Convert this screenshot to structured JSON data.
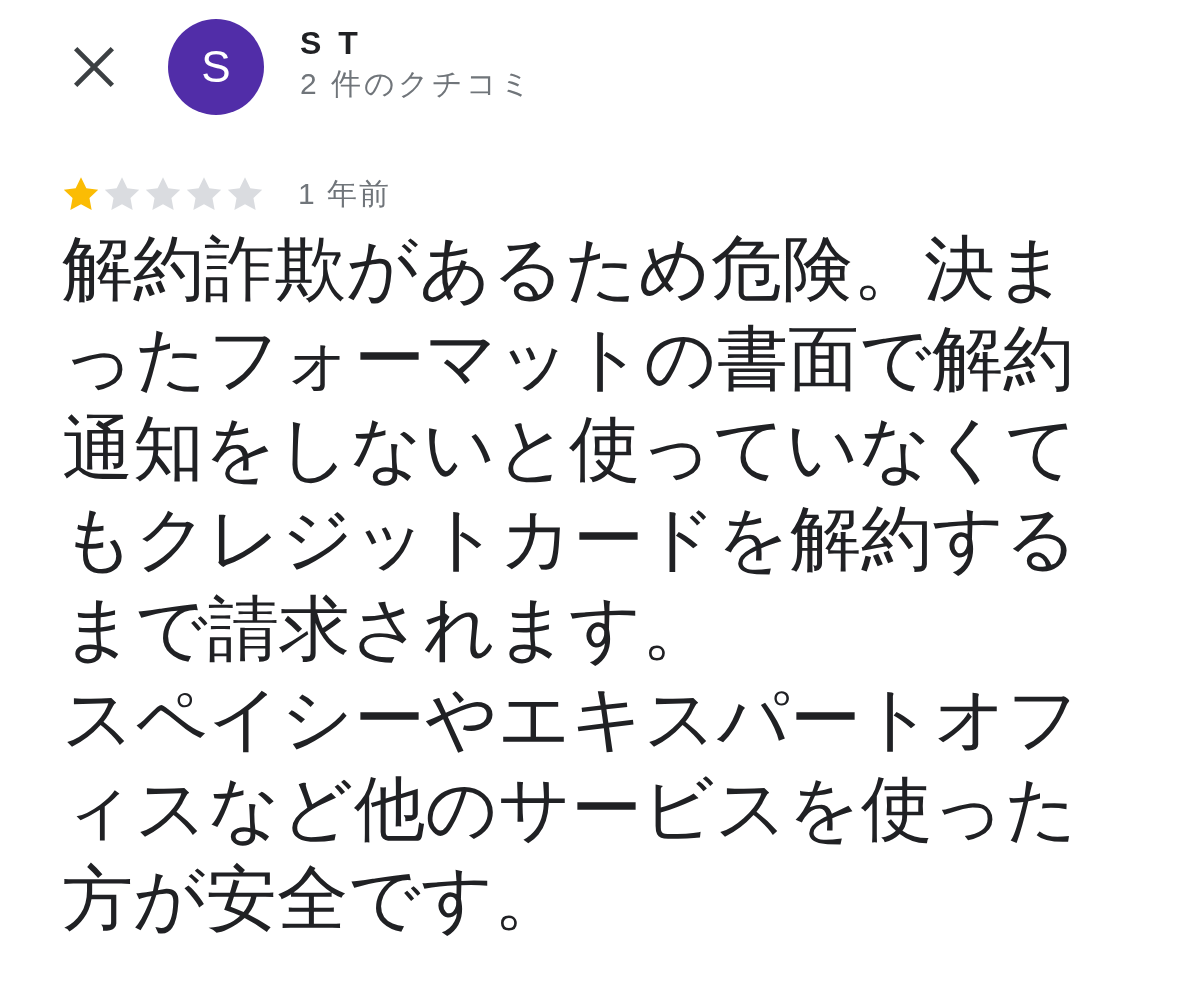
{
  "reviewer": {
    "initial": "S",
    "name": "S T",
    "review_count": "2 件のクチコミ"
  },
  "review": {
    "stars": 1,
    "time": "1 年前",
    "paragraphs": [
      "解約詐欺があるため危険。決まったフォーマットの書面で解約通知をしないと使っていなくてもクレジットカードを解約するまで請求されます。",
      "スペイシーやエキスパートオフィスなど他のサービスを使った方が安全です。"
    ]
  }
}
